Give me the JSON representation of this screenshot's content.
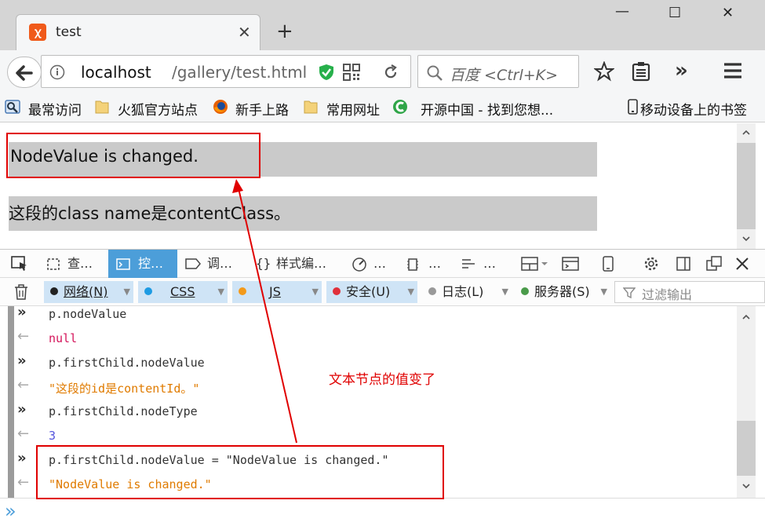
{
  "browser": {
    "tab": {
      "title": "test",
      "close": "✕"
    },
    "new_tab": "+",
    "window": {
      "minimize": "—",
      "maximize": "☐",
      "close": "✕"
    },
    "url": {
      "host": "localhost",
      "path": "/gallery/test.html"
    },
    "search_placeholder": "百度 <Ctrl+K>",
    "overflow": "»"
  },
  "bookmarks": {
    "items": [
      "最常访问",
      "火狐官方站点",
      "新手上路",
      "常用网址",
      "开源中国 - 找到您想..."
    ],
    "mobile": "移动设备上的书签"
  },
  "page": {
    "line1": "NodeValue is changed.",
    "line2": "这段的class name是contentClass。"
  },
  "devtools": {
    "tabs": [
      "查…",
      "控…",
      "调…",
      "样式编…",
      "…",
      "…",
      "…"
    ],
    "filters": {
      "net": "网络(N)",
      "css": "CSS",
      "js": "JS",
      "security": "安全(U)",
      "log": "日志(L)",
      "server": "服务器(S)",
      "filter_placeholder": "过滤输出"
    },
    "console": [
      {
        "kind": "input",
        "text": "p.nodeValue"
      },
      {
        "kind": "output",
        "text": "null"
      },
      {
        "kind": "input",
        "text": "p.firstChild.nodeValue"
      },
      {
        "kind": "output",
        "text": "\"这段的id是contentId。\""
      },
      {
        "kind": "input",
        "text": "p.firstChild.nodeType"
      },
      {
        "kind": "output",
        "text": "3"
      },
      {
        "kind": "input",
        "text": "p.firstChild.nodeValue = \"NodeValue is changed.\""
      },
      {
        "kind": "output",
        "text": "\"NodeValue is changed.\""
      }
    ],
    "prompt": "»"
  },
  "annotation": {
    "label": "文本节点的值变了",
    "color": "#e00000"
  },
  "colors": {
    "selected_tab": "#4c9ed9",
    "null_color": "#d4145a",
    "string_color": "#e07b00",
    "number_color": "#5555dd",
    "highlight": "#cacaca"
  }
}
